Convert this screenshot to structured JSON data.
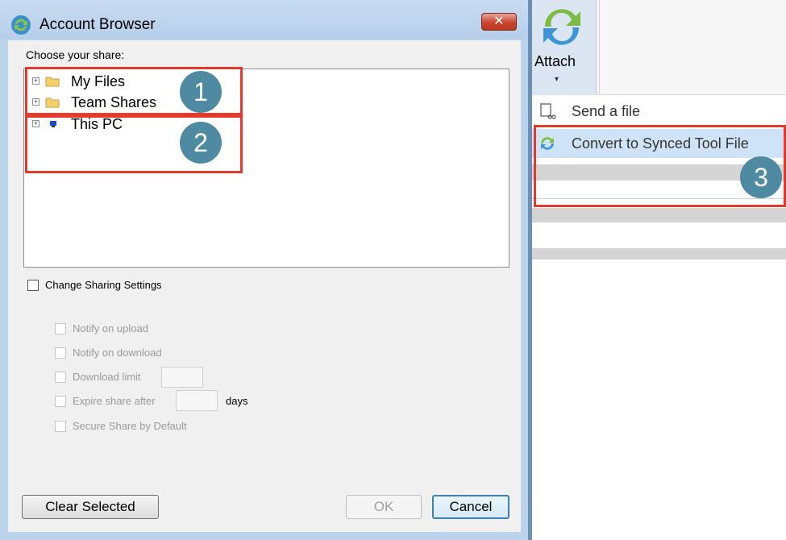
{
  "dialog": {
    "title": "Account Browser",
    "close_glyph": "✕",
    "choose_label": "Choose your share:",
    "tree": [
      {
        "label": "My Files",
        "expander": "+",
        "icon": "folder-icon"
      },
      {
        "label": "Team Shares",
        "expander": "+",
        "icon": "folder-icon"
      },
      {
        "label": "This PC",
        "expander": "+",
        "icon": "computer-icon"
      }
    ],
    "change_sharing": {
      "label": "Change Sharing Settings",
      "checked": false
    },
    "options": {
      "notify_upload": "Notify on upload",
      "notify_download": "Notify on download",
      "download_limit": "Download limit",
      "download_limit_value": "",
      "expire_share": "Expire share after",
      "expire_value": "",
      "days": "days",
      "secure_share": "Secure Share by Default"
    },
    "buttons": {
      "clear": "Clear Selected",
      "ok": "OK",
      "cancel": "Cancel"
    }
  },
  "annotations": {
    "one": "1",
    "two": "2",
    "three": "3",
    "color": "#e23b2e",
    "badge_color": "#4e8aa1"
  },
  "ribbon": {
    "attach_label": "Attach",
    "attach_arrow": "▾"
  },
  "menu": {
    "send_file": "Send a file",
    "convert": "Convert to Synced Tool File"
  }
}
